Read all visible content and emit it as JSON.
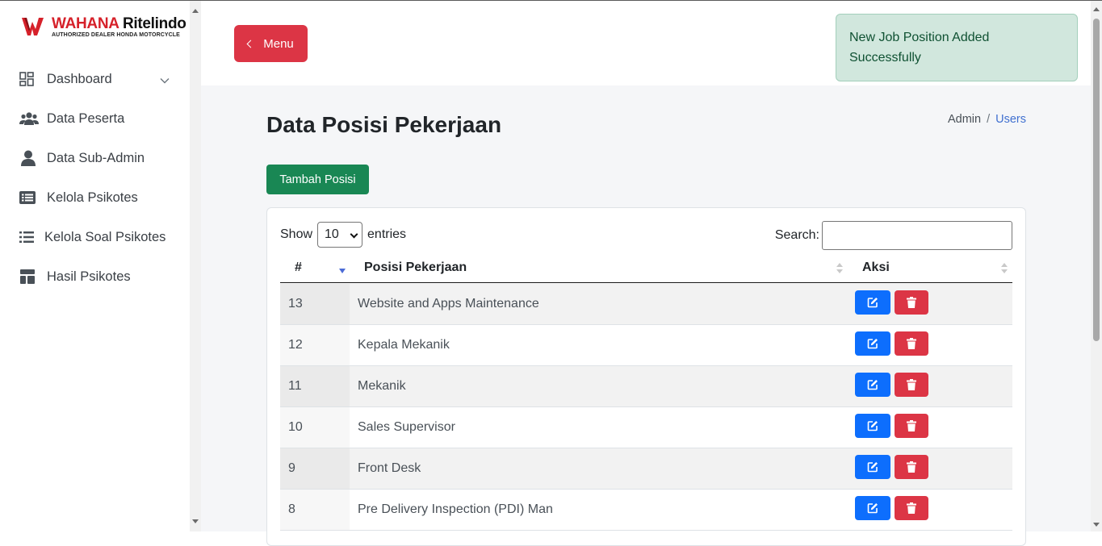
{
  "brand": {
    "name_part1": "WAHANA",
    "name_part2": "Ritelindo",
    "tagline": "AUTHORIZED DEALER HONDA MOTORCYCLE",
    "accent_color": "#d6212a"
  },
  "sidebar": {
    "items": [
      {
        "label": "Dashboard",
        "icon": "dashboard-icon"
      },
      {
        "label": "Data Peserta",
        "icon": "users-icon"
      },
      {
        "label": "Data Sub-Admin",
        "icon": "user-icon"
      },
      {
        "label": "Kelola Psikotes",
        "icon": "list-alt-icon"
      },
      {
        "label": "Kelola Soal Psikotes",
        "icon": "list-icon"
      },
      {
        "label": "Hasil Psikotes",
        "icon": "layout-icon"
      }
    ]
  },
  "topbar": {
    "menu_label": "Menu",
    "alert_text": "New Job Position Added Successfully"
  },
  "page": {
    "title": "Data Posisi Pekerjaan",
    "breadcrumb": {
      "root": "Admin",
      "separator": "/",
      "current": "Users"
    },
    "add_button": "Tambah Posisi"
  },
  "table": {
    "length_prefix": "Show",
    "length_value": "10",
    "length_suffix": "entries",
    "search_label": "Search:",
    "search_value": "",
    "columns": [
      "#",
      "Posisi Pekerjaan",
      "Aksi"
    ],
    "rows": [
      {
        "num": "13",
        "name": "Website and Apps Maintenance"
      },
      {
        "num": "12",
        "name": "Kepala Mekanik"
      },
      {
        "num": "11",
        "name": "Mekanik"
      },
      {
        "num": "10",
        "name": "Sales Supervisor"
      },
      {
        "num": "9",
        "name": "Front Desk"
      },
      {
        "num": "8",
        "name": "Pre Delivery Inspection (PDI) Man"
      }
    ]
  },
  "colors": {
    "primary": "#0d6efd",
    "danger": "#dc3545",
    "success": "#198754",
    "alert_bg": "#d1e7dd"
  }
}
